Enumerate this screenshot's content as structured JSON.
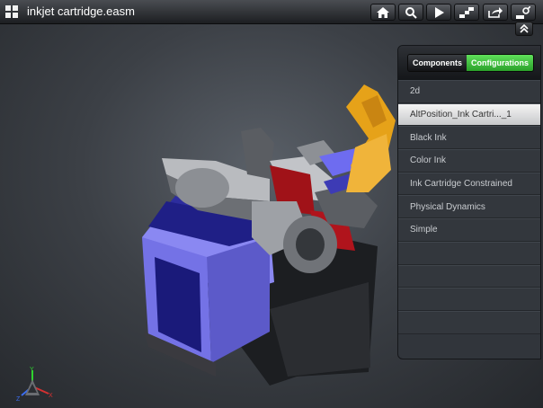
{
  "app": {
    "title": "inkjet cartridge.easm"
  },
  "toolbar": {
    "icons": [
      "home-icon",
      "zoom-icon",
      "play-icon",
      "views-icon",
      "share-icon",
      "settings-icon"
    ]
  },
  "panel": {
    "tabs": [
      {
        "label": "Components",
        "active": false
      },
      {
        "label": "Configurations",
        "active": true
      }
    ],
    "items": [
      {
        "label": "2d"
      },
      {
        "label": "AltPosition_Ink Cartri..._1"
      },
      {
        "label": "Black Ink"
      },
      {
        "label": "Color Ink"
      },
      {
        "label": "Ink Cartridge Constrained"
      },
      {
        "label": "Physical Dynamics"
      },
      {
        "label": "Simple"
      },
      {
        "label": ""
      },
      {
        "label": ""
      },
      {
        "label": ""
      },
      {
        "label": ""
      }
    ],
    "selected_index": 1
  },
  "triad": {
    "x": "X",
    "y": "Y",
    "z": "Z"
  },
  "colors": {
    "accent_green": "#3cc23c",
    "model_blue": "#2a2a9a",
    "model_purple": "#7b79ee",
    "model_yellow": "#e6a219",
    "model_red": "#b0141c"
  }
}
